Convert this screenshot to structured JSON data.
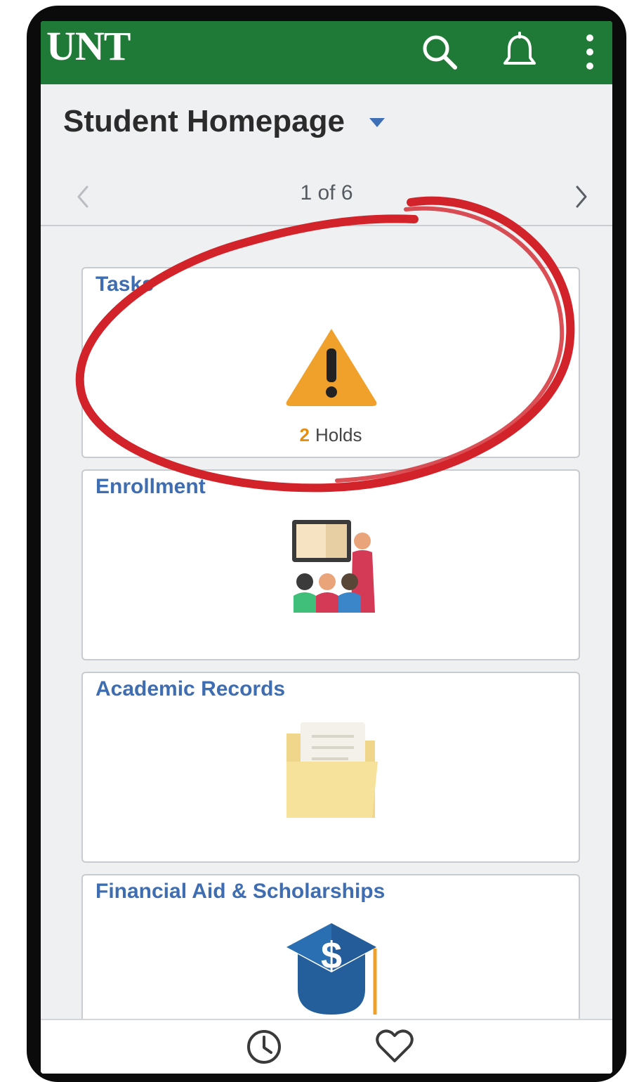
{
  "header": {
    "logo": "UNT",
    "icons": [
      "search-icon",
      "bell-icon",
      "kebab-menu-icon"
    ],
    "bar_color": "#1f7a38"
  },
  "page": {
    "title": "Student Homepage",
    "pager": "1 of 6"
  },
  "tiles": [
    {
      "title": "Tasks",
      "icon": "warning-icon",
      "holds_count": "2",
      "holds_label": "Holds"
    },
    {
      "title": "Enrollment",
      "icon": "classroom-icon"
    },
    {
      "title": "Academic Records",
      "icon": "folder-icon"
    },
    {
      "title": "Financial Aid & Scholarships",
      "icon": "graduation-cap-dollar-icon"
    }
  ],
  "footer": {
    "icons": [
      "recent-history-icon",
      "favorites-heart-icon"
    ]
  },
  "colors": {
    "accent_blue": "#3f6db2",
    "warning": "#f0a12c",
    "annotation": "#d2232a"
  }
}
